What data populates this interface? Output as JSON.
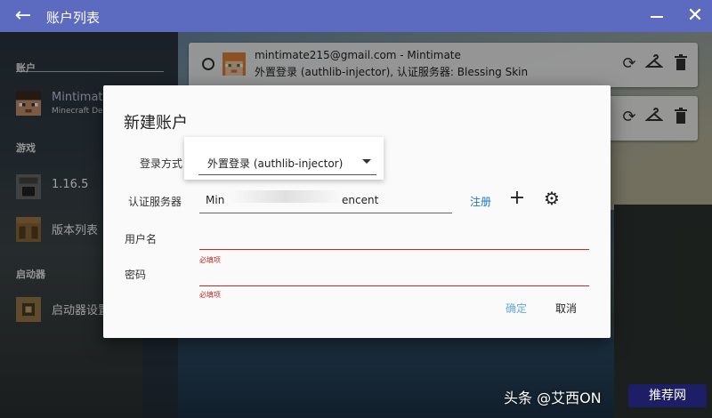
{
  "window": {
    "title": "账户列表"
  },
  "sidebar": {
    "sections": [
      {
        "label": "账户"
      },
      {
        "label": "游戏"
      },
      {
        "label": "启动器"
      }
    ],
    "account": {
      "name": "Mintimate",
      "sub": "Minecraft De"
    },
    "games": [
      {
        "label": "1.16.5"
      },
      {
        "label": "版本列表"
      }
    ],
    "launcher": {
      "label": "启动器设置"
    }
  },
  "accounts": [
    {
      "line1": "mintimate215@gmail.com - Mintimate",
      "line2": "外置登录 (authlib-injector), 认证服务器: Blessing Skin"
    }
  ],
  "dialog": {
    "title": "新建账户",
    "method_label": "登录方式",
    "method_value": "外置登录 (authlib-injector)",
    "server_label": "认证服务器",
    "server_value_start": "Min",
    "server_value_end": "encent",
    "register": "注册",
    "username_label": "用户名",
    "password_label": "密码",
    "required": "必填项",
    "ok": "确定",
    "cancel": "取消"
  },
  "watermark": {
    "text": "头条 @艾西ON",
    "logo": "推荐网"
  }
}
